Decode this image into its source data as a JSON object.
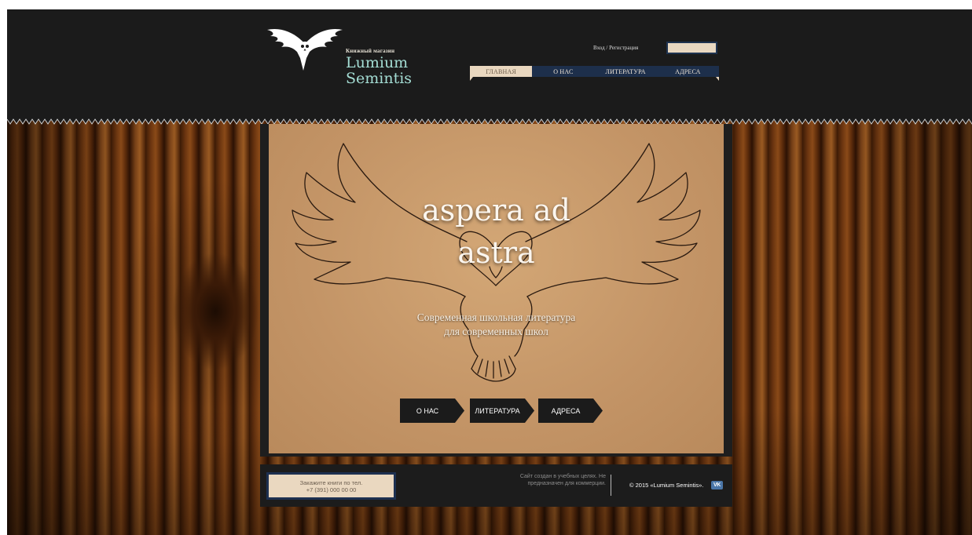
{
  "header": {
    "logo_small": "Книжный магазин",
    "logo_line1": "Lumium",
    "logo_line2": "Semintis",
    "login_link": "Вход / Регистрация",
    "search_value": ""
  },
  "nav": {
    "items": [
      "ГЛАВНАЯ",
      "О НАС",
      "ЛИТЕРАТУРА",
      "АДРЕСА"
    ],
    "active_index": 0
  },
  "hero": {
    "title_line1": "aspera ad",
    "title_line2": "astra",
    "subtitle_line1": "Современная школьная литература",
    "subtitle_line2": "для современных школ",
    "buttons": [
      "О НАС",
      "ЛИТЕРАТУРА",
      "АДРЕСА"
    ]
  },
  "footer": {
    "order_line1": "Закажите книги по тел.",
    "order_line2": "+7 (391) 000 00 00",
    "note_line1": "Сайт создан в учебных целях. Не",
    "note_line2": "предназначен для коммерции.",
    "copyright": "© 2015 «Lumium Semintis».",
    "vk_label": "VK"
  },
  "colors": {
    "header_bg": "#1b1b1b",
    "nav_bg": "#1d2f4b",
    "nav_active_bg": "#e9d7bf",
    "logo_text": "#a4ddd4",
    "panel_paper": "#c99c6c",
    "vk_blue": "#4a76a8"
  },
  "icons": {
    "logo": "owl-logo-icon",
    "hero": "owl-outline-icon",
    "social": "vk-icon"
  }
}
